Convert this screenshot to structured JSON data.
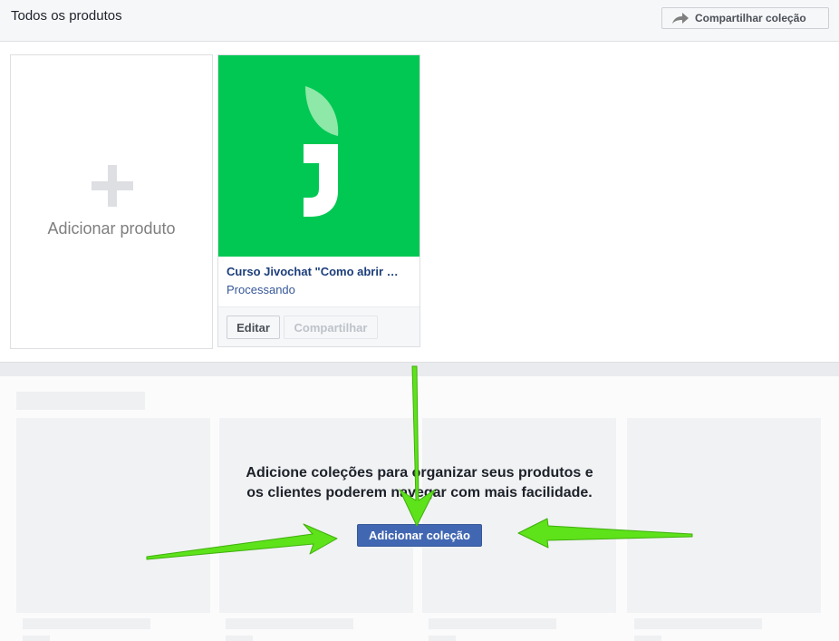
{
  "header": {
    "title": "Todos os produtos",
    "share_collection_label": "Compartilhar coleção",
    "share_icon": "share-arrow-icon"
  },
  "add_product": {
    "label": "Adicionar produto",
    "icon": "plus-icon"
  },
  "product": {
    "name": "Curso Jivochat \"Como abrir …",
    "status": "Processando",
    "edit_label": "Editar",
    "share_label": "Compartilhar",
    "image_icon": "jivochat-logo-icon",
    "image_color": "#00c853"
  },
  "collections": {
    "empty_message": "Adicione coleções para organizar seus produtos e os clientes poderem navegar com mais facilidade.",
    "add_collection_label": "Adicionar coleção"
  },
  "annotations": {
    "arrow_color": "#5ee21a",
    "arrow_count": 3
  }
}
